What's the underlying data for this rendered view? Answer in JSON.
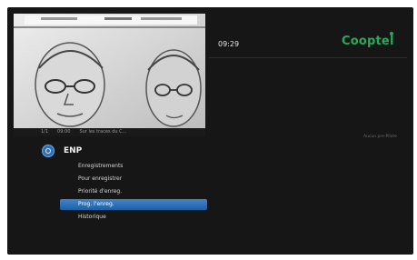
{
  "header": {
    "time": "09:29",
    "brand": "Cooptel"
  },
  "video": {
    "strip_items": [
      "1/1",
      "09:00",
      "Sur les traces du C..."
    ]
  },
  "right_panel": {
    "hint": "Aucun pre-Pilote"
  },
  "menu": {
    "title": "ENP",
    "items": [
      {
        "label": "Enregistrements",
        "selected": false
      },
      {
        "label": "Pour enregistrer",
        "selected": false
      },
      {
        "label": "Priorité d'enreg.",
        "selected": false
      },
      {
        "label": "Prog. l'enreg.",
        "selected": true
      },
      {
        "label": "Historique",
        "selected": false
      }
    ]
  },
  "colors": {
    "background": "#161616",
    "brand_green": "#2aa95a",
    "selection_blue": "#2f6fb6"
  },
  "icons": {
    "section_icon": "recording-icon"
  }
}
